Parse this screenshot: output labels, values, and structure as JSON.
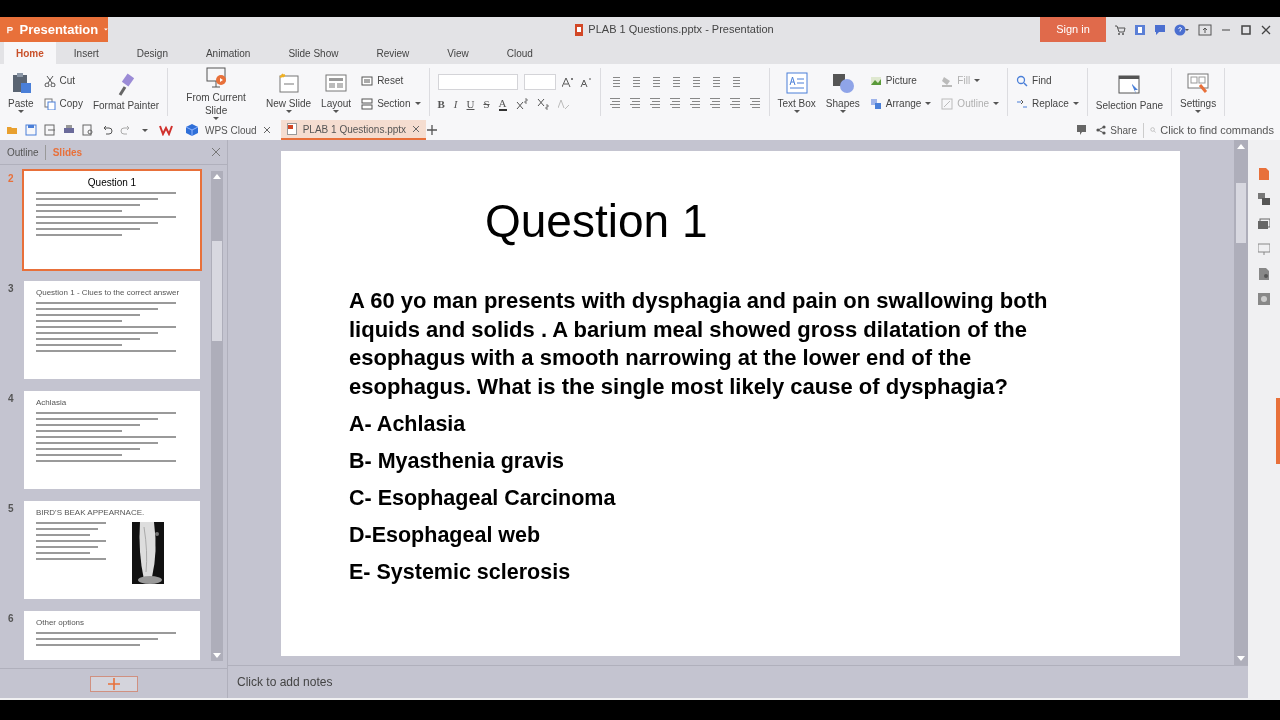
{
  "app_menu": {
    "label": "Presentation"
  },
  "window": {
    "title": "PLAB 1 Questions.pptx - Presentation",
    "sign_in": "Sign in"
  },
  "ribbon_tabs": [
    {
      "label": "Home",
      "selected": true
    },
    {
      "label": "Insert",
      "selected": false
    },
    {
      "label": "Design",
      "selected": false
    },
    {
      "label": "Animation",
      "selected": false
    },
    {
      "label": "Slide Show",
      "selected": false
    },
    {
      "label": "Review",
      "selected": false
    },
    {
      "label": "View",
      "selected": false
    },
    {
      "label": "Cloud",
      "selected": false
    }
  ],
  "ribbon_groups": [
    {
      "columns": [
        [
          {
            "label": "Paste",
            "kind": "large",
            "caret": true
          }
        ],
        [
          {
            "label": "Cut",
            "kind": "small",
            "caret": false
          },
          {
            "label": "Copy",
            "kind": "small",
            "caret": false
          }
        ],
        [
          {
            "label": "Format Painter",
            "kind": "large",
            "caret": false
          }
        ]
      ]
    },
    {
      "columns": [
        [
          {
            "label": "From Current Slide",
            "kind": "large",
            "caret": true
          }
        ],
        [
          {
            "label": "New Slide",
            "kind": "large",
            "caret": true
          }
        ],
        [
          {
            "label": "Layout",
            "kind": "large",
            "caret": true
          }
        ],
        [
          {
            "label": "Reset",
            "kind": "small",
            "caret": false
          },
          {
            "label": "Section",
            "kind": "small",
            "caret": true
          }
        ]
      ]
    },
    {
      "kind": "font",
      "format_buttons": [
        "B",
        "I",
        "U",
        "S",
        "A"
      ]
    },
    {
      "kind": "paragraph"
    },
    {
      "columns": [
        [
          {
            "label": "Text Box",
            "kind": "large",
            "caret": true
          }
        ],
        [
          {
            "label": "Shapes",
            "kind": "large",
            "caret": true
          }
        ],
        [
          {
            "label": "Picture",
            "kind": "small",
            "caret": false
          },
          {
            "label": "Arrange",
            "kind": "small",
            "caret": true
          }
        ],
        [
          {
            "label": "Fill",
            "kind": "small",
            "caret": true,
            "disabled": true
          },
          {
            "label": "Outline",
            "kind": "small",
            "caret": true,
            "disabled": true
          }
        ]
      ]
    },
    {
      "columns": [
        [
          {
            "label": "Find",
            "kind": "small",
            "caret": false
          },
          {
            "label": "Replace",
            "kind": "small",
            "caret": true
          }
        ]
      ]
    },
    {
      "columns": [
        [
          {
            "label": "Selection Pane",
            "kind": "large",
            "caret": false
          }
        ]
      ]
    },
    {
      "columns": [
        [
          {
            "label": "Settings",
            "kind": "large",
            "caret": true
          }
        ]
      ]
    }
  ],
  "doc_tabs": [
    {
      "label": "WPS Cloud",
      "selected": false
    },
    {
      "label": "PLAB 1 Questions.pptx",
      "selected": true
    }
  ],
  "share": "Share",
  "command_search": {
    "placeholder": "Click to find commands"
  },
  "panel_tabs": [
    {
      "label": "Outline",
      "selected": false
    },
    {
      "label": "Slides",
      "selected": true
    }
  ],
  "thumbnails": [
    {
      "number": "2",
      "title": "Question 1",
      "selected": true
    },
    {
      "number": "3",
      "title": "Question 1 - Clues to the correct answer",
      "selected": false
    },
    {
      "number": "4",
      "title": "Achlasia",
      "selected": false
    },
    {
      "number": "5",
      "title": "BIRD'S BEAK APPEARNACE.",
      "selected": false
    },
    {
      "number": "6",
      "title": "Other options",
      "selected": false
    }
  ],
  "slide": {
    "title": "Question 1",
    "question": "A 60 yo man presents with dysphagia and pain on swallowing both liquids and solids . A barium meal showed gross dilatation of the esophagus with a smooth narrowing at the lower end of the esophagus. What is the single most likely cause of dysphagia?",
    "options": [
      "A- Achlasia",
      "B- Myasthenia gravis",
      "C- Esophageal Carcinoma",
      "D-Esophageal web",
      "E- Systemic sclerosis"
    ]
  },
  "notes": {
    "placeholder": "Click to add notes"
  }
}
